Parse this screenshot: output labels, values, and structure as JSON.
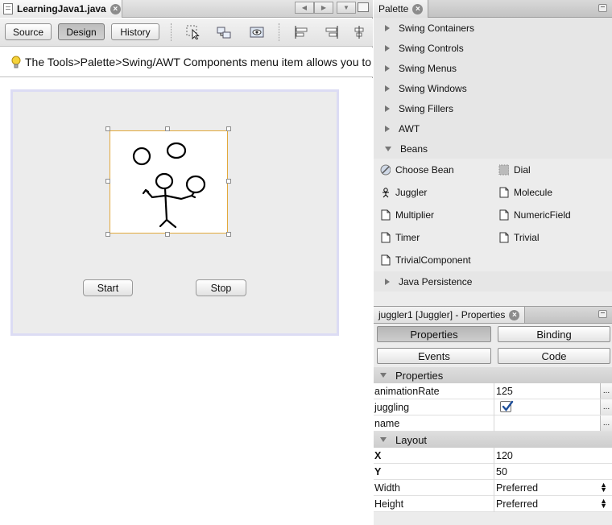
{
  "editor": {
    "tab_title": "LearningJava1.java",
    "views": {
      "source": "Source",
      "design": "Design",
      "history": "History"
    },
    "hint": "The Tools>Palette>Swing/AWT Components menu item allows you to"
  },
  "form": {
    "start_label": "Start",
    "stop_label": "Stop"
  },
  "palette": {
    "title": "Palette",
    "categories": [
      "Swing Containers",
      "Swing Controls",
      "Swing Menus",
      "Swing Windows",
      "Swing Fillers",
      "AWT",
      "Beans",
      "Java Persistence"
    ],
    "beans": [
      "Choose Bean",
      "Dial",
      "Juggler",
      "Molecule",
      "Multiplier",
      "NumericField",
      "Timer",
      "Trivial",
      "TrivialComponent"
    ]
  },
  "properties": {
    "title": "juggler1 [Juggler] - Properties",
    "buttons": {
      "properties": "Properties",
      "binding": "Binding",
      "events": "Events",
      "code": "Code"
    },
    "section_properties": "Properties",
    "section_layout": "Layout",
    "rows": [
      {
        "key": "animationRate",
        "value": "125"
      },
      {
        "key": "juggling",
        "value": ""
      },
      {
        "key": "name",
        "value": ""
      }
    ],
    "layout_rows": [
      {
        "key": "X",
        "value": "120"
      },
      {
        "key": "Y",
        "value": "50"
      },
      {
        "key": "Width",
        "value": "Preferred"
      },
      {
        "key": "Height",
        "value": "Preferred"
      }
    ],
    "juggling_checked": true
  }
}
